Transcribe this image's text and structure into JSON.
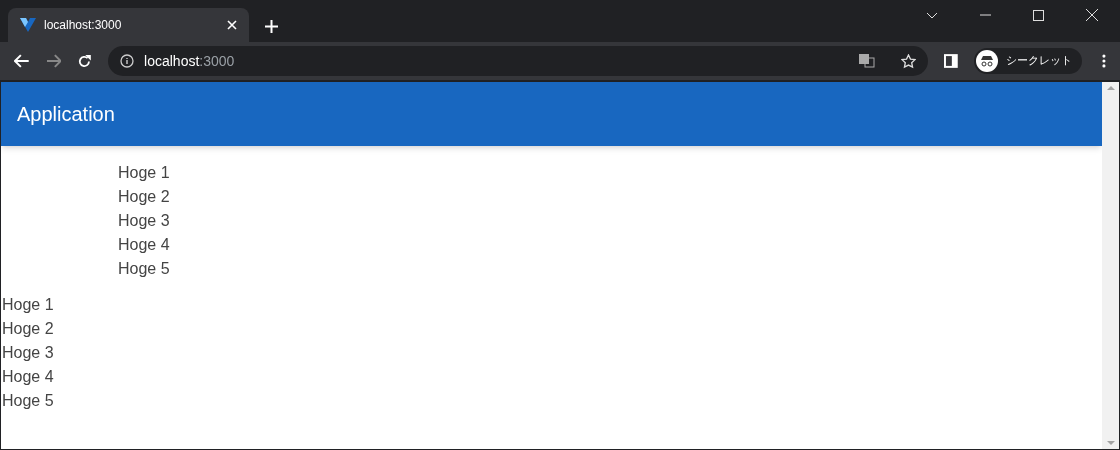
{
  "browser": {
    "tab": {
      "title": "localhost:3000",
      "selected": true
    },
    "address": {
      "host": "localhost",
      "port": ":3000"
    },
    "profile": {
      "label": "シークレット"
    }
  },
  "app_bar": {
    "title": "Application"
  },
  "indented_list": [
    "Hoge 1",
    "Hoge 2",
    "Hoge 3",
    "Hoge 4",
    "Hoge 5"
  ],
  "plain_list": [
    "Hoge 1",
    "Hoge 2",
    "Hoge 3",
    "Hoge 4",
    "Hoge 5"
  ]
}
